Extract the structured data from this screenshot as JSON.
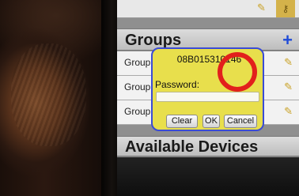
{
  "top_row": {
    "label": "",
    "edit_icon": "pencil-icon",
    "key_icon": "key-icon"
  },
  "groups": {
    "title": "Groups",
    "add_icon": "plus-icon",
    "rows": [
      {
        "label": "Group",
        "edit_icon": "pencil-icon"
      },
      {
        "label": "Group",
        "edit_icon": "pencil-icon"
      },
      {
        "label": "Group",
        "edit_icon": "pencil-icon"
      }
    ]
  },
  "available_devices": {
    "title": "Available Devices"
  },
  "password_dialog": {
    "device_id": "08B015310146",
    "password_label": "Password:",
    "password_value": "",
    "clear_label": "Clear",
    "ok_label": "OK",
    "cancel_label": "Cancel",
    "background_color": "#e8df4c",
    "border_color": "#3a4bd6"
  },
  "highlight": {
    "shape": "circle",
    "color": "#e2201c"
  }
}
